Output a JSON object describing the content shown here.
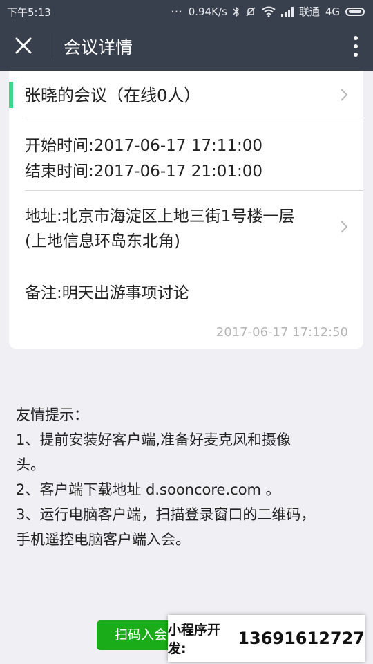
{
  "status_bar": {
    "time": "下午5:13",
    "dots": "···",
    "network_speed": "0.94K/s",
    "carrier": "联通",
    "network_type": "4G",
    "icons": [
      "bluetooth-icon",
      "mute-icon",
      "wifi-icon",
      "signal-icon",
      "battery-icon"
    ]
  },
  "header": {
    "title": "会议详情",
    "close_icon": "close-icon",
    "more_icon": "more-vertical-icon"
  },
  "meeting": {
    "title": "张晓的会议（在线0人）",
    "start_time": "开始时间:2017-06-17 17:11:00",
    "end_time": "结束时间:2017-06-17 21:01:00",
    "address_line1": "地址:北京市海淀区上地三街1号楼一层",
    "address_line2": "(上地信息环岛东北角)",
    "note": "备注:明天出游事项讨论",
    "created_at": "2017-06-17 17:12:50",
    "accent_color": "#3dd68c"
  },
  "tips": {
    "heading": "友情提示：",
    "lines": [
      "1、提前安装好客户端,准备好麦克风和摄像",
      "头。",
      "2、客户端下载地址 d.sooncore.com 。",
      "3、运行电脑客户端，扫描登录窗口的二维码，",
      "手机遥控电脑客户端入会。"
    ]
  },
  "actions": {
    "scan_label": "扫码入会",
    "button_color": "#1aad19"
  },
  "promo": {
    "label": "小程序开发:",
    "phone": "13691612727"
  }
}
